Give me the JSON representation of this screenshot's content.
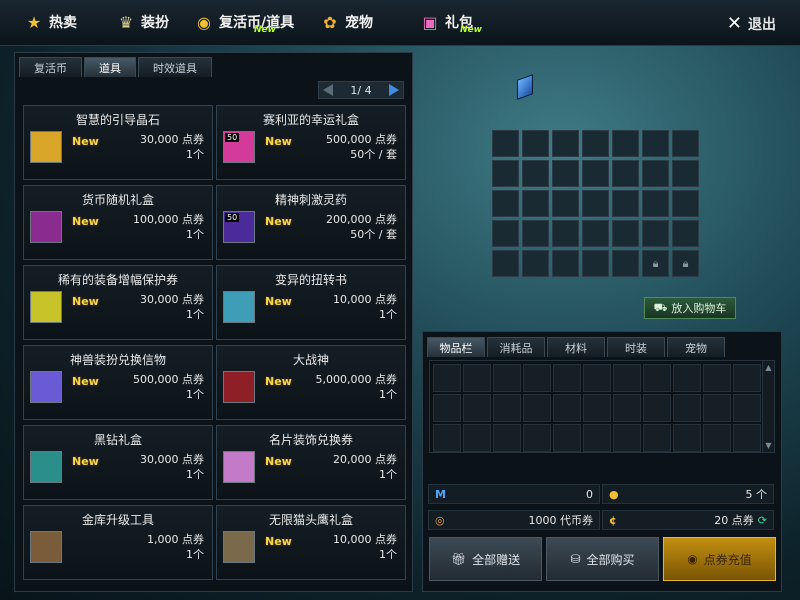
{
  "nav": {
    "hot": "热卖",
    "outfit": "装扮",
    "revive": "复活币/道具",
    "revive_badge": "New",
    "pet": "宠物",
    "gift": "礼包",
    "gift_badge": "New",
    "exit": "退出"
  },
  "left_tabs": [
    "复活币",
    "道具",
    "时效道具"
  ],
  "pager": "1/ 4",
  "items": [
    {
      "name": "智慧的引导晶石",
      "new": "New",
      "price": "30,000 点券",
      "qty": "1个",
      "icon": "orb-icon",
      "color": "#d9a62a"
    },
    {
      "name": "赛利亚的幸运礼盒",
      "new": "New",
      "price": "500,000 点券",
      "qty": "50个 / 套",
      "icon": "gift-box-icon",
      "color": "#d43a9a",
      "tag": "50"
    },
    {
      "name": "货币随机礼盒",
      "new": "New",
      "price": "100,000 点券",
      "qty": "1个",
      "icon": "dice-box-icon",
      "color": "#8a2b8f"
    },
    {
      "name": "精神刺激灵药",
      "new": "New",
      "price": "200,000 点券",
      "qty": "50个 / 套",
      "icon": "potion-icon",
      "color": "#4b2a9c",
      "tag": "50"
    },
    {
      "name": "稀有的装备增幅保护券",
      "new": "New",
      "price": "30,000 点券",
      "qty": "1个",
      "icon": "ticket-icon",
      "color": "#c9c32a"
    },
    {
      "name": "变异的扭转书",
      "new": "New",
      "price": "10,000 点券",
      "qty": "1个",
      "icon": "book-icon",
      "color": "#3e9db7"
    },
    {
      "name": "神兽装扮兑换信物",
      "new": "New",
      "price": "500,000 点券",
      "qty": "1个",
      "icon": "card-icon",
      "color": "#6b5ad6"
    },
    {
      "name": "大战神",
      "new": "New",
      "price": "5,000,000 点券",
      "qty": "1个",
      "icon": "warrior-icon",
      "color": "#8e1f27"
    },
    {
      "name": "黑钻礼盒",
      "new": "New",
      "price": "30,000 点券",
      "qty": "1个",
      "icon": "diamond-box-icon",
      "color": "#2a8e8a"
    },
    {
      "name": "名片装饰兑换券",
      "new": "New",
      "price": "20,000 点券",
      "qty": "1个",
      "icon": "coupon-icon",
      "color": "#c27ac9"
    },
    {
      "name": "金库升级工具",
      "new": "",
      "price": "1,000 点券",
      "qty": "1个",
      "icon": "chest-icon",
      "color": "#7a5c3a"
    },
    {
      "name": "无限猫头鹰礼盒",
      "new": "New",
      "price": "10,000 点券",
      "qty": "1个",
      "icon": "owl-icon",
      "color": "#7a6a4b"
    }
  ],
  "cart_button": "放入购物车",
  "bag_tabs": [
    "物品栏",
    "消耗品",
    "材料",
    "时装",
    "宠物"
  ],
  "stats": {
    "m_value": "0",
    "coin_value": "5 个",
    "currency_value": "1000 代币券",
    "points_value": "20 点券"
  },
  "actions": {
    "gift_all": "全部赠送",
    "buy_all": "全部购买",
    "recharge": "点券充值"
  }
}
